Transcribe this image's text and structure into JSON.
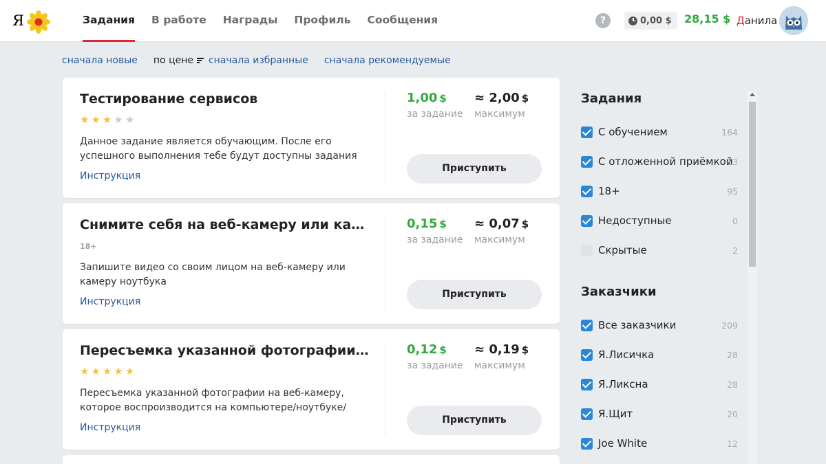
{
  "header": {
    "logo_text": "Я",
    "nav": [
      {
        "label": "Задания",
        "active": true
      },
      {
        "label": "В работе",
        "active": false
      },
      {
        "label": "Награды",
        "active": false
      },
      {
        "label": "Профиль",
        "active": false
      },
      {
        "label": "Сообщения",
        "active": false
      }
    ],
    "help": "?",
    "balance_pending": "0,00 $",
    "balance": "28,15 $",
    "user_first_letter": "Д",
    "user_rest": "анила"
  },
  "sort": {
    "newest": "сначала новые",
    "price": "по цене",
    "favorites": "сначала избранные",
    "recommended": "сначала рекомендуемые"
  },
  "tasks": [
    {
      "title": "Тестирование сервисов",
      "rating": 3,
      "badge": "",
      "description": "Данное задание является обучающим. После его успешного выполнения тебе будут доступны задания по проверке...",
      "link": "Инструкция",
      "price": "1,00",
      "price_max": "≈ 2,00",
      "currency": "$",
      "price_label": "за задание",
      "max_label": "максимум",
      "button": "Приступить"
    },
    {
      "title": "Снимите себя на веб-камеру или камеру но...",
      "rating": null,
      "badge": "18+",
      "description": "Запишите видео со своим лицом на веб-камеру или камеру ноутбука",
      "link": "Инструкция",
      "price": "0,15",
      "price_max": "≈ 0,07",
      "currency": "$",
      "price_label": "за задание",
      "max_label": "максимум",
      "button": "Приступить"
    },
    {
      "title": "Пересъемка указанной фотографии на веб-...",
      "rating": 5,
      "badge": "",
      "description": "Пересъемка указанной фотографии на веб-камеру, которое воспроизводится на компьютере/ноутбуке/мобильном...",
      "link": "Инструкция",
      "price": "0,12",
      "price_max": "≈ 0,19",
      "currency": "$",
      "price_label": "за задание",
      "max_label": "максимум",
      "button": "Приступить"
    }
  ],
  "sidebar": {
    "tasks_title": "Задания",
    "task_filters": [
      {
        "label": "С обучением",
        "count": "164",
        "checked": true
      },
      {
        "label": "С отложенной приёмкой",
        "count": "13",
        "checked": true
      },
      {
        "label": "18+",
        "count": "95",
        "checked": true
      },
      {
        "label": "Недоступные",
        "count": "0",
        "checked": true
      },
      {
        "label": "Скрытые",
        "count": "2",
        "checked": false
      }
    ],
    "customers_title": "Заказчики",
    "customer_filters": [
      {
        "label": "Все заказчики",
        "count": "209",
        "checked": true
      },
      {
        "label": "Я.Лисичка",
        "count": "28",
        "checked": true
      },
      {
        "label": "Я.Ликсна",
        "count": "28",
        "checked": true
      },
      {
        "label": "Я.Щит",
        "count": "20",
        "checked": true
      },
      {
        "label": "Joe White",
        "count": "12",
        "checked": true
      }
    ]
  },
  "colors": {
    "accent_red": "#e0292f",
    "money_green": "#2faa3b",
    "link_blue": "#2a5aa0",
    "checkbox_blue": "#2a87d8",
    "star_gold": "#f0c24a"
  }
}
